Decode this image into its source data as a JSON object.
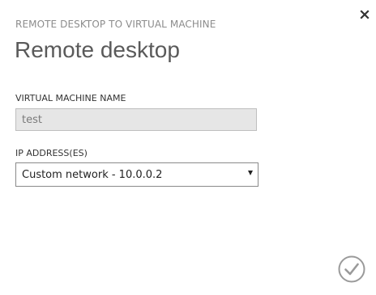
{
  "dialog": {
    "subheading": "REMOTE DESKTOP TO VIRTUAL MACHINE",
    "title": "Remote desktop"
  },
  "form": {
    "vm_name_label": "VIRTUAL MACHINE NAME",
    "vm_name_value": "test",
    "ip_label": "IP ADDRESS(ES)",
    "ip_selected": "Custom network - 10.0.0.2"
  },
  "icons": {
    "close": "close-icon",
    "ok": "checkmark-circle-icon",
    "dropdown": "triangle-down-icon"
  },
  "colors": {
    "input_disabled_bg": "#e6e6e6",
    "accent_gray": "#8c8c8c"
  }
}
